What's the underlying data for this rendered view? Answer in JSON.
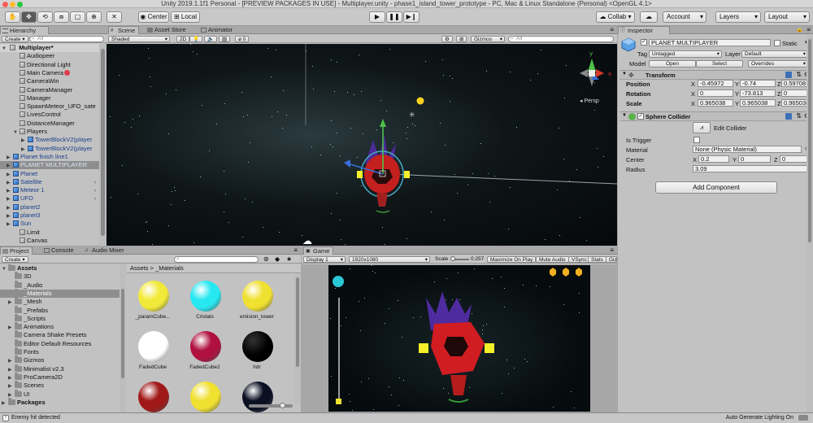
{
  "window": {
    "title": "Unity 2019.1.1f1 Personal - [PREVIEW PACKAGES IN USE] - Multiplayer.unity - phase1_island_tower_prototype - PC, Mac & Linux Standalone (Personal) <OpenGL 4.1>"
  },
  "toolbar": {
    "center_label": "Center",
    "local_label": "Local",
    "collab_label": "Collab ▾",
    "account_label": "Account",
    "layers_label": "Layers",
    "layout_label": "Layout"
  },
  "hierarchy": {
    "tab_label": "Hierarchy",
    "create_label": "Create ▾",
    "search_placeholder": "All",
    "scene_name": "Multiplayer*",
    "items": [
      {
        "label": "Audiopeer"
      },
      {
        "label": "Directional Light"
      },
      {
        "label": "Main Camera"
      },
      {
        "label": "CameraWin"
      },
      {
        "label": "CameraManager"
      },
      {
        "label": "Manager"
      },
      {
        "label": "SpawnMeteor_UFO_sate"
      },
      {
        "label": "LivesControl"
      },
      {
        "label": "DistanceManager"
      },
      {
        "label": "Players"
      },
      {
        "label": "TowerBlockV2(player"
      },
      {
        "label": "TowerBlockV2(player"
      },
      {
        "label": "Planet finish line1"
      },
      {
        "label": "PLANET MULTIPLAYER"
      },
      {
        "label": "Planet"
      },
      {
        "label": "Satellite"
      },
      {
        "label": "Meteor 1"
      },
      {
        "label": "UFO"
      },
      {
        "label": "planet2"
      },
      {
        "label": "planet3"
      },
      {
        "label": "Sun"
      },
      {
        "label": "Limit"
      },
      {
        "label": "Canvas"
      }
    ]
  },
  "scene": {
    "tab_scene": "Scene",
    "tab_asset_store": "Asset Store",
    "tab_animator": "Animator",
    "shading_mode": "Shaded",
    "mode_2d": "2D",
    "fx_count": "0",
    "gizmos_label": "Gizmos",
    "search_placeholder": "All",
    "persp_label": "Persp"
  },
  "inspector": {
    "tab_label": "Inspector",
    "object_name": "PLANET MULTIPLAYER",
    "static_label": "Static",
    "tag_label": "Tag",
    "tag_value": "Untagged",
    "layer_label": "Layer",
    "layer_value": "Default",
    "model_label": "Model",
    "open_label": "Open",
    "select_label": "Select",
    "overrides_label": "Overrides",
    "transform": {
      "title": "Transform",
      "position_label": "Position",
      "rotation_label": "Rotation",
      "scale_label": "Scale",
      "position": {
        "x": "-0.45972",
        "y": "-0.74",
        "z": "0.59708"
      },
      "rotation": {
        "x": "0",
        "y": "-73.813",
        "z": "0"
      },
      "scale": {
        "x": "0.965038",
        "y": "0.965038",
        "z": "0.965038"
      }
    },
    "sphere_collider": {
      "title": "Sphere Collider",
      "edit_label": "Edit Collider",
      "is_trigger_label": "Is Trigger",
      "material_label": "Material",
      "material_value": "None (Physic Material)",
      "center_label": "Center",
      "center": {
        "x": "0.2",
        "y": "0",
        "z": "0"
      },
      "radius_label": "Radius",
      "radius_value": "3.09"
    },
    "add_component_label": "Add Component"
  },
  "project": {
    "tab_project": "Project",
    "tab_console": "Console",
    "tab_audio_mixer": "Audio Mixer",
    "create_label": "Create ▾",
    "breadcrumb_root": "Assets",
    "breadcrumb_sep": ">",
    "breadcrumb_leaf": "_Materials",
    "tree": [
      {
        "label": "Assets",
        "indent": 0,
        "arrow": "▼"
      },
      {
        "label": "3D",
        "indent": 1,
        "arrow": ""
      },
      {
        "label": "_Audio",
        "indent": 1,
        "arrow": ""
      },
      {
        "label": "_Materials",
        "indent": 1,
        "arrow": ""
      },
      {
        "label": "_Mesh",
        "indent": 1,
        "arrow": "▶"
      },
      {
        "label": "_Prefabs",
        "indent": 1,
        "arrow": ""
      },
      {
        "label": "_Scripts",
        "indent": 1,
        "arrow": ""
      },
      {
        "label": "Animations",
        "indent": 1,
        "arrow": "▶"
      },
      {
        "label": "Camera Shake Presets",
        "indent": 1,
        "arrow": ""
      },
      {
        "label": "Editor Default Resources",
        "indent": 1,
        "arrow": ""
      },
      {
        "label": "Fonts",
        "indent": 1,
        "arrow": ""
      },
      {
        "label": "Gizmos",
        "indent": 1,
        "arrow": "▶"
      },
      {
        "label": "Minimalist v2.3",
        "indent": 1,
        "arrow": "▶"
      },
      {
        "label": "ProCamera2D",
        "indent": 1,
        "arrow": "▶"
      },
      {
        "label": "Scenes",
        "indent": 1,
        "arrow": "▶"
      },
      {
        "label": "UI",
        "indent": 1,
        "arrow": "▶"
      },
      {
        "label": "Packages",
        "indent": 0,
        "arrow": "▶"
      }
    ],
    "materials": [
      {
        "label": "_paramCube...",
        "color": "#f2ea3a"
      },
      {
        "label": "Cristals",
        "color": "#27e8f0"
      },
      {
        "label": "emision_tower",
        "color": "#f0e030"
      },
      {
        "label": "FadedCube",
        "color": "#ffffff"
      },
      {
        "label": "FadedCube2",
        "color": "#b0103e"
      },
      {
        "label": "hdr",
        "color": "#000000"
      },
      {
        "label": "",
        "color": "#a01818"
      },
      {
        "label": "",
        "color": "#f0e030"
      },
      {
        "label": "",
        "color": "#0a0f22"
      }
    ]
  },
  "game": {
    "tab_label": "Game",
    "display_label": "Display 1",
    "resolution_label": "1920x1080",
    "scale_label": "Scale",
    "scale_value": "0.257",
    "maximize_label": "Maximize On Play",
    "mute_label": "Mute Audio",
    "vsync_label": "VSync",
    "stats_label": "Stats",
    "gizmos_label": "Giz"
  },
  "status": {
    "message": "Enemy hit detected",
    "right_message": "Auto Generate Lighting On"
  }
}
